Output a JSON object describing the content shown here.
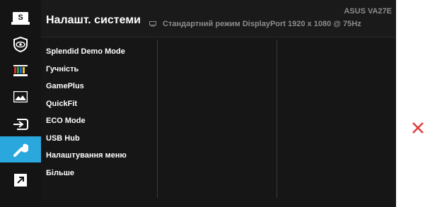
{
  "sidebar": {
    "items": [
      {
        "name": "splendid",
        "icon": "splendid-s-icon",
        "label": "S",
        "active": false
      },
      {
        "name": "eye-care",
        "icon": "eye-shield-icon",
        "active": false
      },
      {
        "name": "color",
        "icon": "color-bars-icon",
        "active": false
      },
      {
        "name": "image",
        "icon": "image-landscape-icon",
        "active": false
      },
      {
        "name": "input-select",
        "icon": "input-arrow-icon",
        "active": false
      },
      {
        "name": "system-setup",
        "icon": "wrench-icon",
        "active": true
      },
      {
        "name": "shortcut",
        "icon": "shortcut-arrow-icon",
        "active": false
      }
    ]
  },
  "header": {
    "title": "Налашт. системи",
    "mode": "Стандартний режим  DisplayPort 1920 x 1080 @ 75Hz",
    "model": "ASUS  VA27E"
  },
  "menu": {
    "items": [
      "Splendid Demo Mode",
      "Гучність",
      "GamePlus",
      "QuickFit",
      "ECO Mode",
      "USB Hub",
      "Налаштування меню",
      "Більше"
    ]
  },
  "keys": {
    "close": "close-x-icon",
    "confirm": "checkmark-icon",
    "up": "arrow-up-icon",
    "down": "arrow-down-icon"
  },
  "colors": {
    "accent": "#2aa7dc",
    "close_red": "#e03a3a",
    "color_bar_red": "#d32f2f",
    "color_bar_green": "#2e9e3e",
    "color_bar_blue": "#1e5fd8",
    "panel_bg": "#161616",
    "header_bg": "#1a1a1a"
  }
}
